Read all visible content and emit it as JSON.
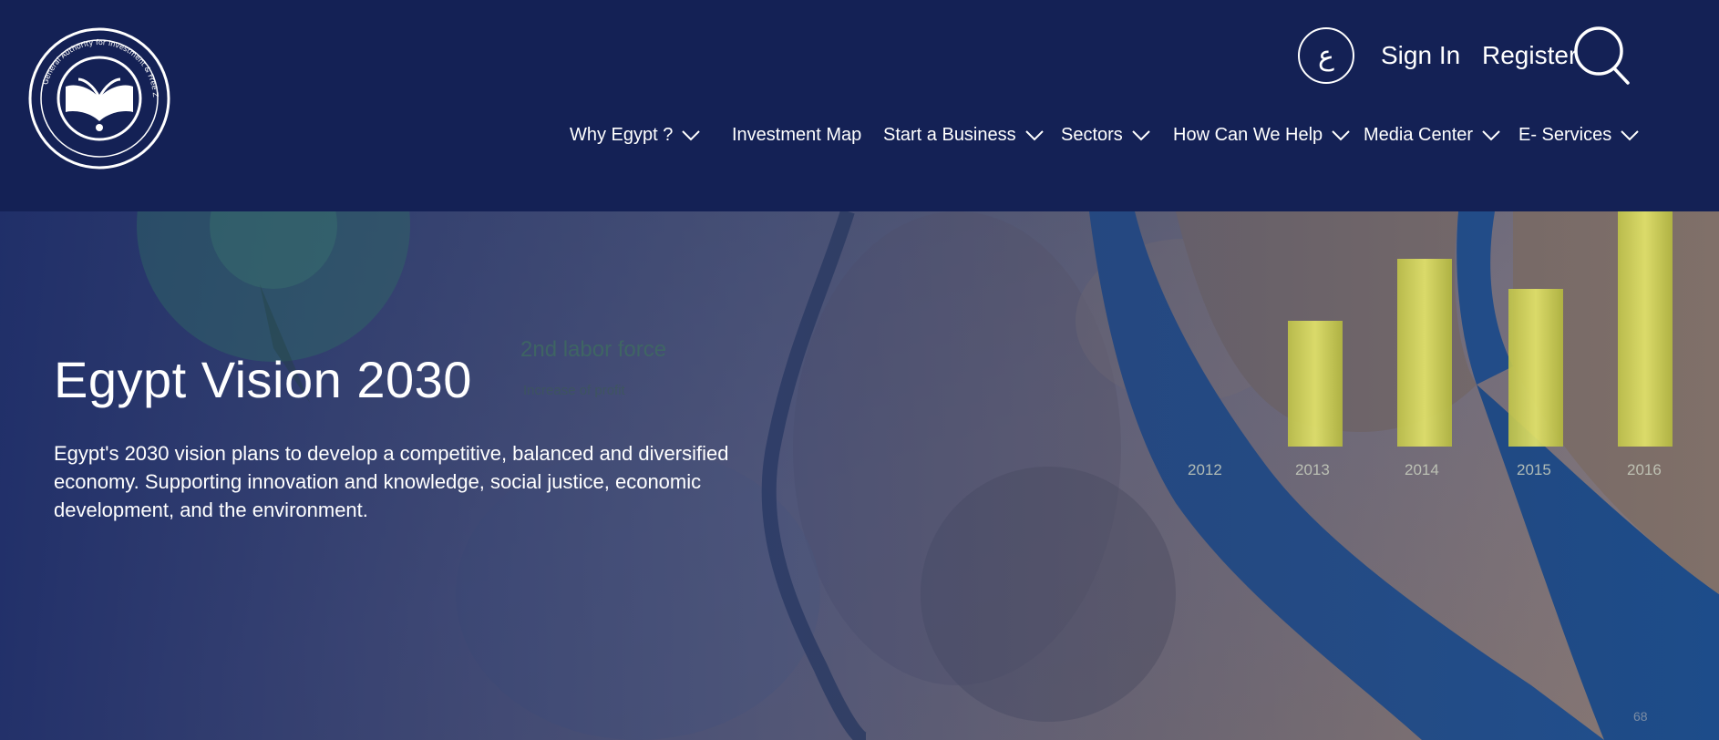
{
  "header": {
    "logo": {
      "name": "gafi-logo",
      "ring_text": "General Authority for Investment & Free Zones"
    },
    "utility": {
      "language_label": "ع",
      "sign_in": "Sign In",
      "register": "Register",
      "search_icon": "search-icon"
    },
    "nav": [
      {
        "label": "Why Egypt ?",
        "has_dropdown": true
      },
      {
        "label": "Investment Map",
        "has_dropdown": false
      },
      {
        "label": "Start a Business",
        "has_dropdown": true
      },
      {
        "label": "Sectors",
        "has_dropdown": true
      },
      {
        "label": "How Can We Help",
        "has_dropdown": true
      },
      {
        "label": "Media Center",
        "has_dropdown": true
      },
      {
        "label": "E- Services",
        "has_dropdown": true
      }
    ]
  },
  "hero": {
    "title": "Egypt Vision 2030",
    "text": "Egypt's 2030 vision plans to develop a competitive, balanced and diversified economy. Supporting innovation and knowledge, social justice, economic development, and the environment.",
    "video_overlay": {
      "headline": "2nd labor force",
      "subline": "Increase of profit",
      "years": [
        "2012",
        "2013",
        "2014",
        "2015",
        "2016"
      ],
      "corner_number": "68"
    }
  },
  "colors": {
    "header_bg": "#142155",
    "text": "#ffffff",
    "bar_fill": "#d8dc5c",
    "sea": "#1f4f8f"
  }
}
